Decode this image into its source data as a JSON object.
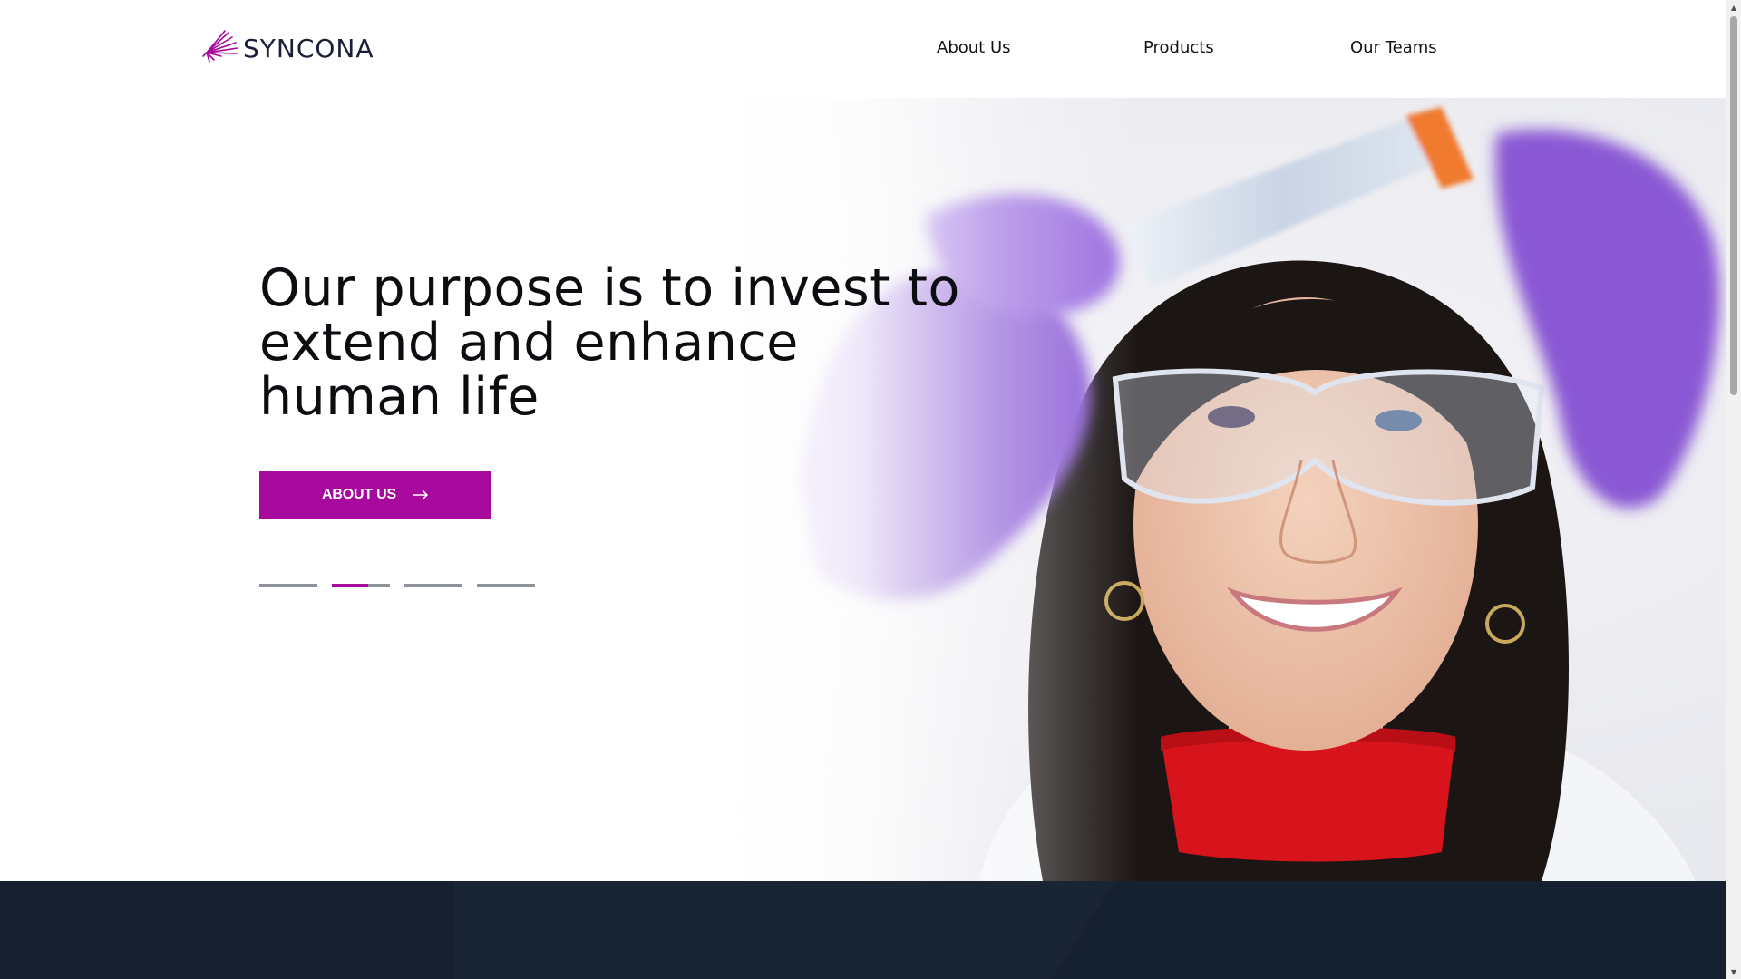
{
  "header": {
    "logo_text": "SYNCONA",
    "nav": {
      "about": "About Us",
      "products": "Products",
      "teams": "Our Teams"
    }
  },
  "hero": {
    "title_lines": [
      "Our purpose is to invest to",
      "extend and enhance",
      "human life"
    ],
    "cta_label": "ABOUT US",
    "carousel": {
      "slides": 4,
      "active_index": 1,
      "active_progress": 0.62
    }
  },
  "colors": {
    "brand": "#a6099b",
    "dark_band": "#16202e",
    "indicator": "#8e929a"
  },
  "icons": {
    "logo": "starburst-logo-icon",
    "cta": "arrow-right-icon",
    "scroll_up": "triangle-up-icon",
    "scroll_down": "triangle-down-icon"
  }
}
